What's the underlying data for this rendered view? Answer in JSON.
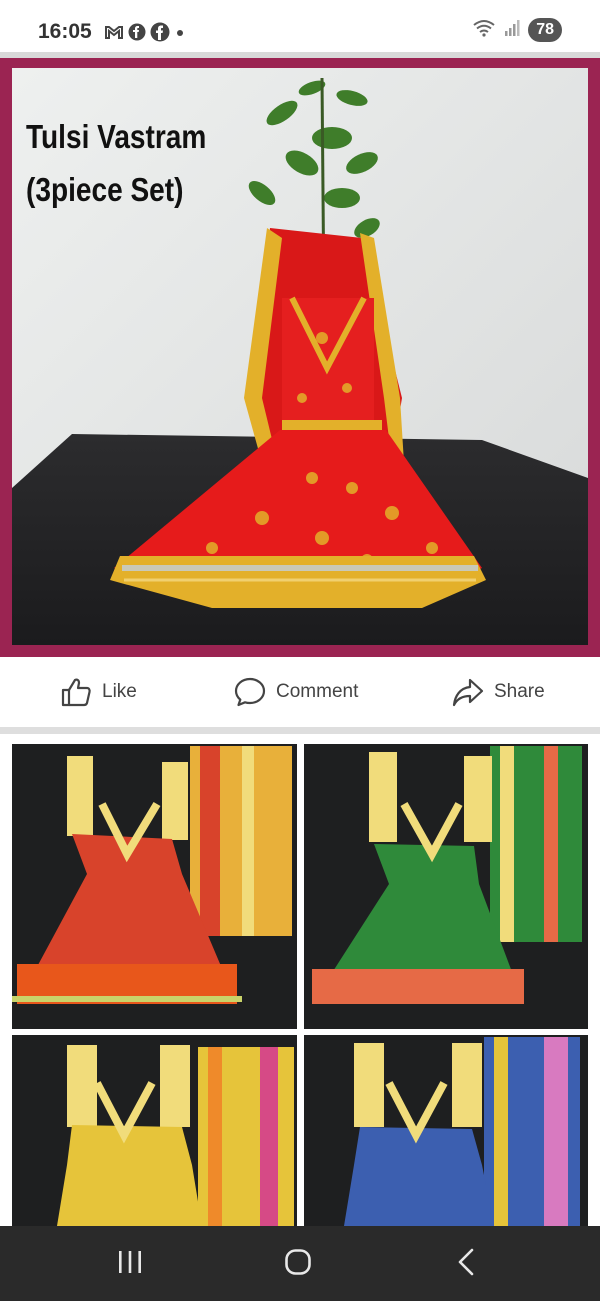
{
  "status": {
    "time": "16:05",
    "battery": "78",
    "left_icons": [
      "gmail-icon",
      "messenger-icon",
      "facebook-icon",
      "dot-icon"
    ],
    "right_icons": [
      "wifi-icon",
      "signal-icon",
      "battery-icon"
    ]
  },
  "post": {
    "title_line1": "Tulsi Vastram",
    "title_line2": "(3piece Set)",
    "frame_color": "#9b2452",
    "garment_color": "#e61b1b",
    "border_color": "#e6b92a"
  },
  "actions": {
    "like": "Like",
    "comment": "Comment",
    "share": "Share"
  },
  "gallery": {
    "variants": [
      "orange",
      "green",
      "yellow",
      "blue"
    ],
    "colors": [
      "#e8571b",
      "#2f8a3a",
      "#e6c43a",
      "#3c5fb0"
    ]
  },
  "nav": {
    "icons": [
      "recent-apps-icon",
      "home-icon",
      "back-icon"
    ]
  }
}
